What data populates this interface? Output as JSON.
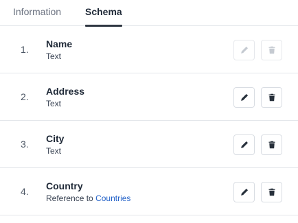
{
  "tabs": [
    {
      "label": "Information",
      "active": false
    },
    {
      "label": "Schema",
      "active": true
    }
  ],
  "fields": [
    {
      "number": "1.",
      "name": "Name",
      "type": "Text",
      "actions_disabled": true
    },
    {
      "number": "2.",
      "name": "Address",
      "type": "Text",
      "actions_disabled": false
    },
    {
      "number": "3.",
      "name": "City",
      "type": "Text",
      "actions_disabled": false
    },
    {
      "number": "4.",
      "name": "Country",
      "type_prefix": "Reference to",
      "type_link": "Countries",
      "actions_disabled": false
    }
  ],
  "icons": {
    "edit": "pencil-icon",
    "delete": "trash-icon"
  },
  "colors": {
    "link": "#2563c9",
    "active_tab_underline": "#2f3742",
    "disabled_icon": "#c5cad1"
  }
}
